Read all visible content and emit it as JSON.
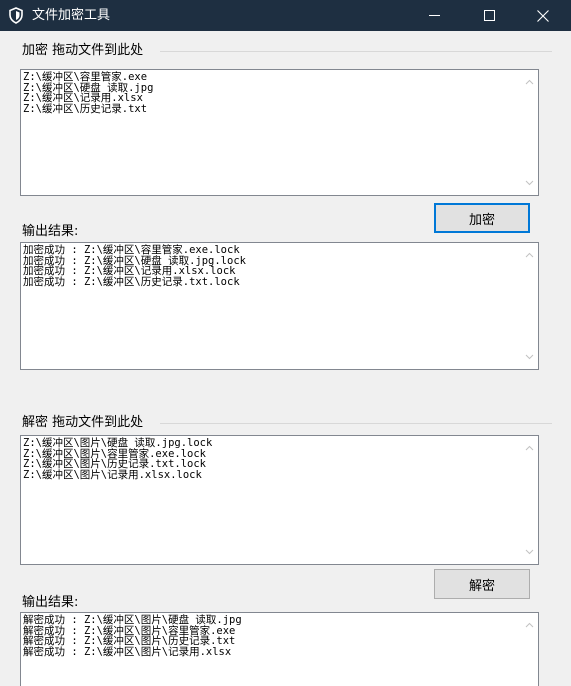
{
  "window": {
    "title": "文件加密工具",
    "icons": {
      "app": "shield-icon",
      "min": "minimize-icon",
      "max": "maximize-icon",
      "close": "close-icon"
    }
  },
  "encrypt": {
    "group_label": "加密 拖动文件到此处",
    "input_lines": "Z:\\缓冲区\\容里管家.exe\nZ:\\缓冲区\\硬盘 读取.jpg\nZ:\\缓冲区\\记录用.xlsx\nZ:\\缓冲区\\历史记录.txt",
    "button_label": "加密",
    "output_label": "输出结果:",
    "output_lines": "加密成功 : Z:\\缓冲区\\容里管家.exe.lock\n加密成功 : Z:\\缓冲区\\硬盘 读取.jpg.lock\n加密成功 : Z:\\缓冲区\\记录用.xlsx.lock\n加密成功 : Z:\\缓冲区\\历史记录.txt.lock"
  },
  "decrypt": {
    "group_label": "解密 拖动文件到此处",
    "input_lines": "Z:\\缓冲区\\图片\\硬盘 读取.jpg.lock\nZ:\\缓冲区\\图片\\容里管家.exe.lock\nZ:\\缓冲区\\图片\\历史记录.txt.lock\nZ:\\缓冲区\\图片\\记录用.xlsx.lock",
    "button_label": "解密",
    "output_label": "输出结果:",
    "output_lines": "解密成功 : Z:\\缓冲区\\图片\\硬盘 读取.jpg\n解密成功 : Z:\\缓冲区\\图片\\容里管家.exe\n解密成功 : Z:\\缓冲区\\图片\\历史记录.txt\n解密成功 : Z:\\缓冲区\\图片\\记录用.xlsx"
  },
  "colors": {
    "titlebar": "#1e2f41",
    "accent": "#0078d7",
    "background": "#f0f0f0"
  }
}
